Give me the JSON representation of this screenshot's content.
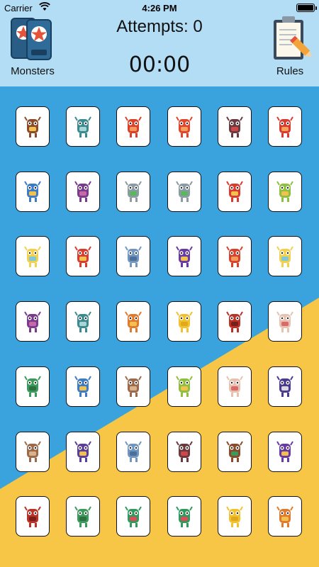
{
  "status_bar": {
    "carrier": "Carrier",
    "time": "4:26 PM"
  },
  "header": {
    "attempts_label": "Attempts: 0",
    "timer": "00:00",
    "monsters_label": "Monsters",
    "rules_label": "Rules"
  },
  "colors": {
    "header_bg": "#b3dcf5",
    "board_blue": "#3aa3dd",
    "board_yellow": "#f7c646"
  },
  "grid": {
    "columns": 6,
    "rows": 7,
    "cards": [
      {
        "monster": "brown-block",
        "color": "#8a4b2a",
        "accent": "#f2c14e"
      },
      {
        "monster": "teal-cyclops",
        "color": "#3b8a8f",
        "accent": "#a6d6d6"
      },
      {
        "monster": "red-square",
        "color": "#d9412b",
        "accent": "#f49a5b"
      },
      {
        "monster": "red-stick",
        "color": "#e0452d",
        "accent": "#f5a15e"
      },
      {
        "monster": "purple-horns",
        "color": "#6b3a3f",
        "accent": "#d14747"
      },
      {
        "monster": "red-round",
        "color": "#d93c2f",
        "accent": "#f4a35a"
      },
      {
        "monster": "blue-kid",
        "color": "#3d7bc4",
        "accent": "#f2c14e"
      },
      {
        "monster": "purple-hat",
        "color": "#7a3b8f",
        "accent": "#c768a8"
      },
      {
        "monster": "robot-grey",
        "color": "#8c9aa3",
        "accent": "#58b85c"
      },
      {
        "monster": "robot-grey",
        "color": "#8c9aa3",
        "accent": "#58b85c"
      },
      {
        "monster": "red-stick-one-eye",
        "color": "#d93c2f",
        "accent": "#f2c14e"
      },
      {
        "monster": "green-yellow",
        "color": "#8fbf3e",
        "accent": "#f2c14e"
      },
      {
        "monster": "yellow-cloud",
        "color": "#f2d04b",
        "accent": "#7ec8d8"
      },
      {
        "monster": "red-stick-one-eye",
        "color": "#d93c2f",
        "accent": "#f2c14e"
      },
      {
        "monster": "blue-horned",
        "color": "#7096bf",
        "accent": "#4c6f99"
      },
      {
        "monster": "purple-blob",
        "color": "#6a3aa3",
        "accent": "#f2c14e"
      },
      {
        "monster": "red-square",
        "color": "#d9412b",
        "accent": "#f49a5b"
      },
      {
        "monster": "yellow-cloud",
        "color": "#f2d04b",
        "accent": "#7ec8d8"
      },
      {
        "monster": "purple-hat",
        "color": "#7a3b8f",
        "accent": "#c768a8"
      },
      {
        "monster": "teal-cyclops",
        "color": "#3b8a8f",
        "accent": "#a6d6d6"
      },
      {
        "monster": "orange-tiger",
        "color": "#e07b2d",
        "accent": "#f2c14e"
      },
      {
        "monster": "yellow-one-eye",
        "color": "#f2c12e",
        "accent": "#e0a81a"
      },
      {
        "monster": "red-horned",
        "color": "#b83228",
        "accent": "#7a1e1a"
      },
      {
        "monster": "pink-pale",
        "color": "#e8c2b0",
        "accent": "#d96a6a"
      },
      {
        "monster": "green-multi-eye",
        "color": "#3a9a5b",
        "accent": "#2e6f42"
      },
      {
        "monster": "blue-kid",
        "color": "#3d7bc4",
        "accent": "#f2c14e"
      },
      {
        "monster": "brown-furry",
        "color": "#9a6a4a",
        "accent": "#d9b38c"
      },
      {
        "monster": "green-yellow",
        "color": "#8fbf3e",
        "accent": "#f2c14e"
      },
      {
        "monster": "pink-pale",
        "color": "#e8c2b0",
        "accent": "#d96a6a"
      },
      {
        "monster": "purple-wizard",
        "color": "#4b3a8f",
        "accent": "#d9d9d9"
      },
      {
        "monster": "brown-furry",
        "color": "#9a6a4a",
        "accent": "#d9b38c"
      },
      {
        "monster": "purple-cyclops",
        "color": "#5a3f9a",
        "accent": "#f2c14e"
      },
      {
        "monster": "blue-horned",
        "color": "#7096bf",
        "accent": "#4c6f99"
      },
      {
        "monster": "purple-horns",
        "color": "#6b3a3f",
        "accent": "#d14747"
      },
      {
        "monster": "brown-block",
        "color": "#8a4b2a",
        "accent": "#3a9a5b"
      },
      {
        "monster": "purple-blob",
        "color": "#6a3aa3",
        "accent": "#f2c14e"
      },
      {
        "monster": "red-horned",
        "color": "#b83228",
        "accent": "#7a1e1a"
      },
      {
        "monster": "green-multi-eye",
        "color": "#3a9a5b",
        "accent": "#2e6f42"
      },
      {
        "monster": "green-tongue",
        "color": "#2f9a5b",
        "accent": "#e04a5a"
      },
      {
        "monster": "green-tongue",
        "color": "#2f9a5b",
        "accent": "#e04a5a"
      },
      {
        "monster": "yellow-one-eye",
        "color": "#f2c12e",
        "accent": "#e0a81a"
      },
      {
        "monster": "orange-tiger",
        "color": "#e07b2d",
        "accent": "#f2c14e"
      }
    ]
  }
}
